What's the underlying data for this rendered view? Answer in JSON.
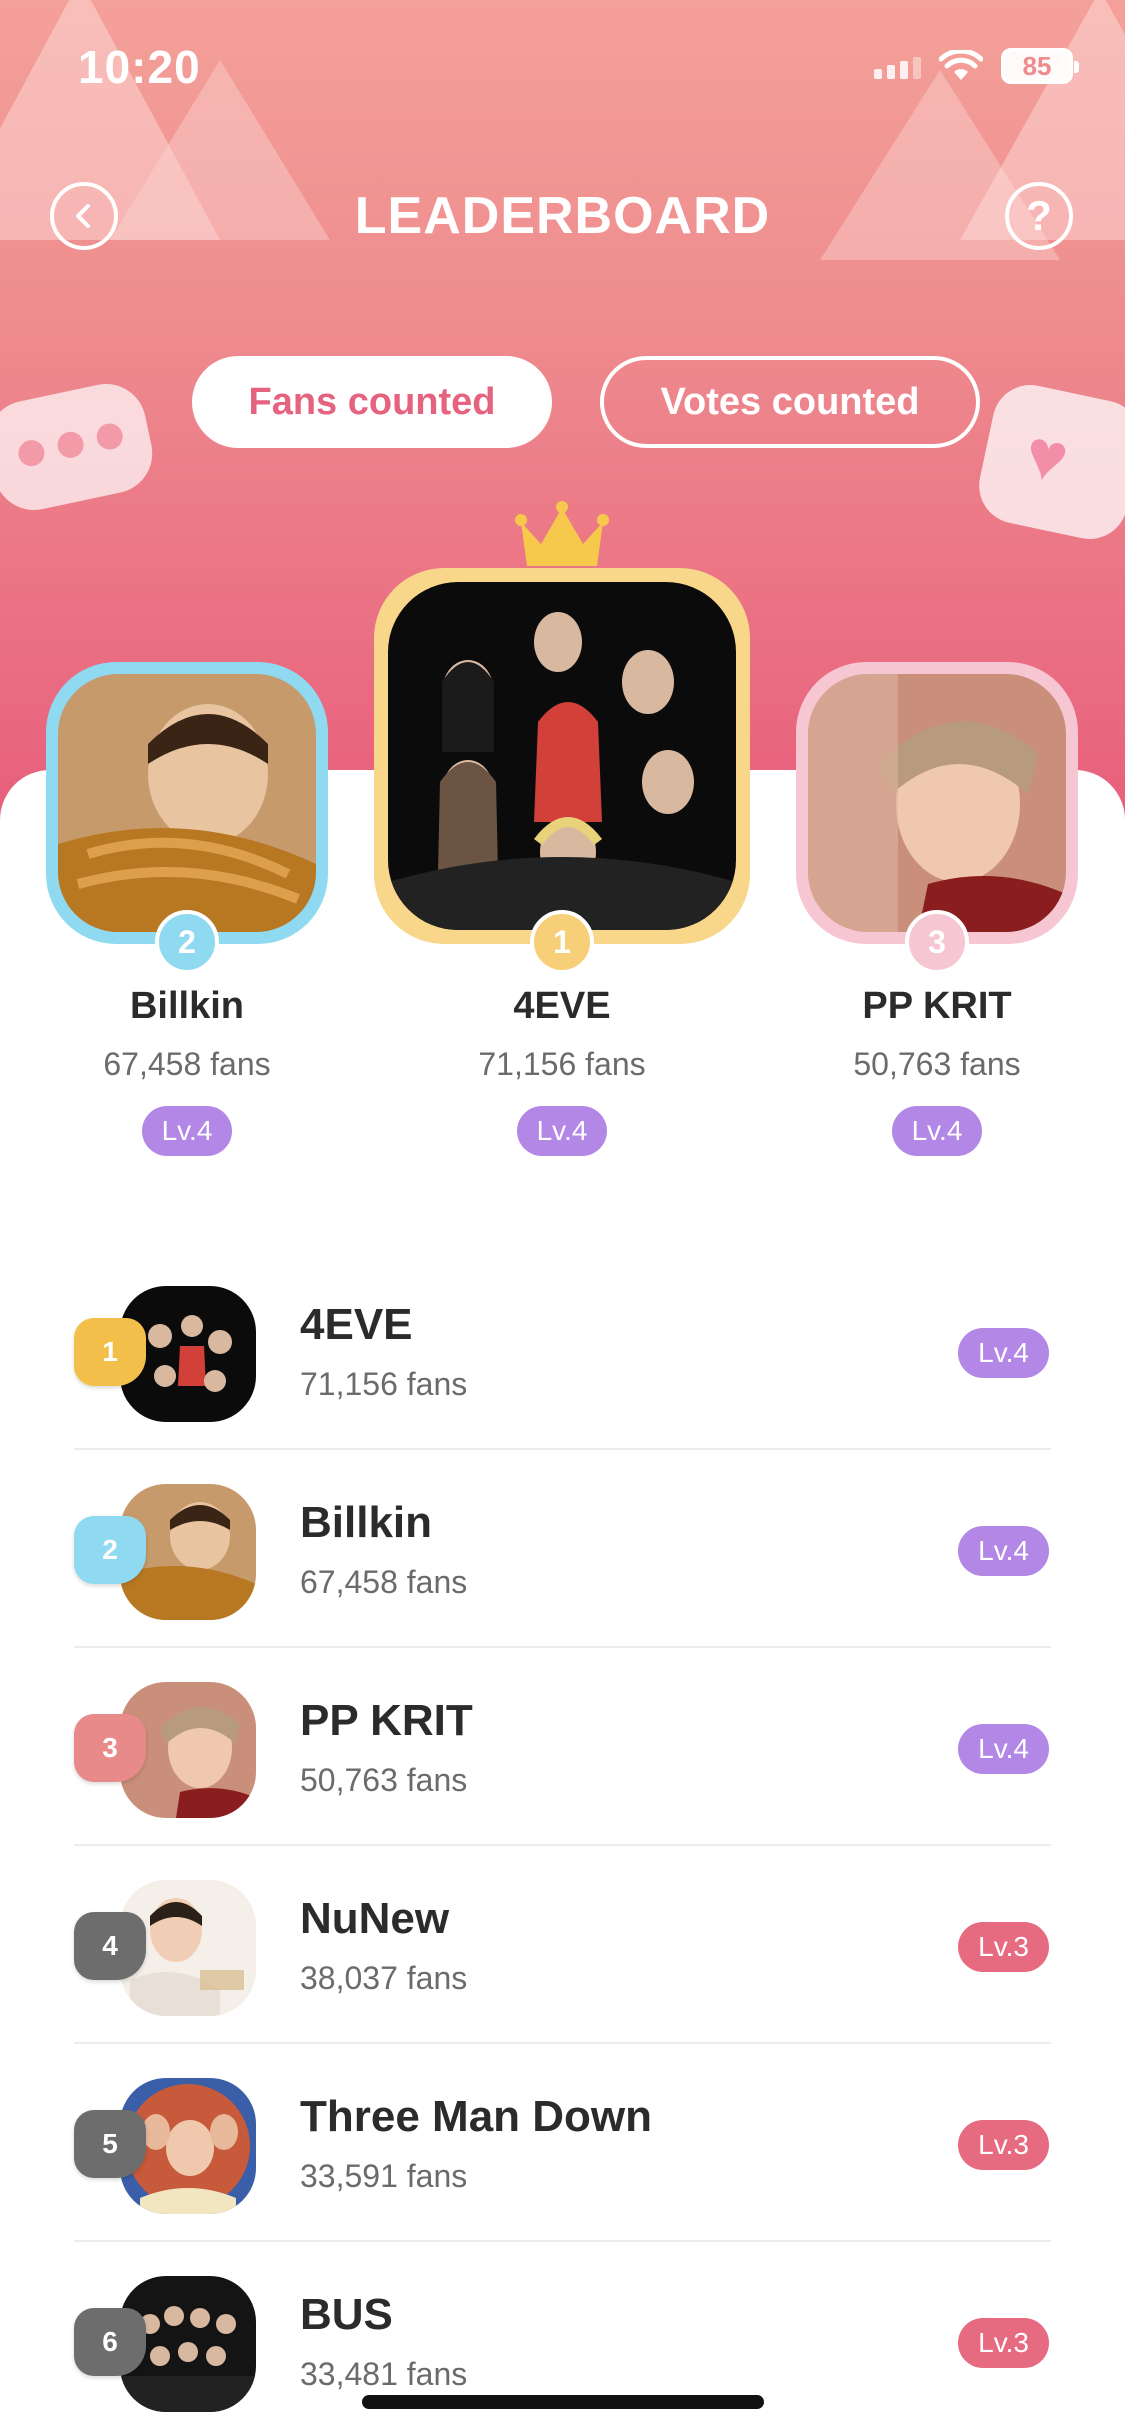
{
  "status_bar": {
    "time": "10:20",
    "battery": "85"
  },
  "header": {
    "title": "LEADERBOARD"
  },
  "tabs": [
    {
      "label": "Fans counted",
      "active": true
    },
    {
      "label": "Votes counted",
      "active": false
    }
  ],
  "colors": {
    "accent_pink": "#e5637f",
    "level_purple": "#b287e6",
    "level_red": "#e66a80",
    "rank1_gold": "#f2c04a",
    "rank2_blue": "#8fdaf0",
    "rank3_pink": "#f0a3aa",
    "rank_gray": "#6d6d6d"
  },
  "podium": [
    {
      "rank": "2",
      "name": "Billkin",
      "fans": "67,458 fans",
      "level": "Lv.4"
    },
    {
      "rank": "1",
      "name": "4EVE",
      "fans": "71,156 fans",
      "level": "Lv.4"
    },
    {
      "rank": "3",
      "name": "PP KRIT",
      "fans": "50,763 fans",
      "level": "Lv.4"
    }
  ],
  "ranking": [
    {
      "rank": "1",
      "name": "4EVE",
      "fans": "71,156 fans",
      "level": "Lv.4"
    },
    {
      "rank": "2",
      "name": "Billkin",
      "fans": "67,458 fans",
      "level": "Lv.4"
    },
    {
      "rank": "3",
      "name": "PP KRIT",
      "fans": "50,763 fans",
      "level": "Lv.4"
    },
    {
      "rank": "4",
      "name": "NuNew",
      "fans": "38,037 fans",
      "level": "Lv.3"
    },
    {
      "rank": "5",
      "name": "Three Man Down",
      "fans": "33,591 fans",
      "level": "Lv.3"
    },
    {
      "rank": "6",
      "name": "BUS",
      "fans": "33,481 fans",
      "level": "Lv.3"
    }
  ],
  "icons": [
    "back-arrow-icon",
    "help-question-icon",
    "crown-icon",
    "chat-bubble-icon",
    "heart-bubble-icon",
    "wifi-icon",
    "signal-icon",
    "battery-icon"
  ]
}
